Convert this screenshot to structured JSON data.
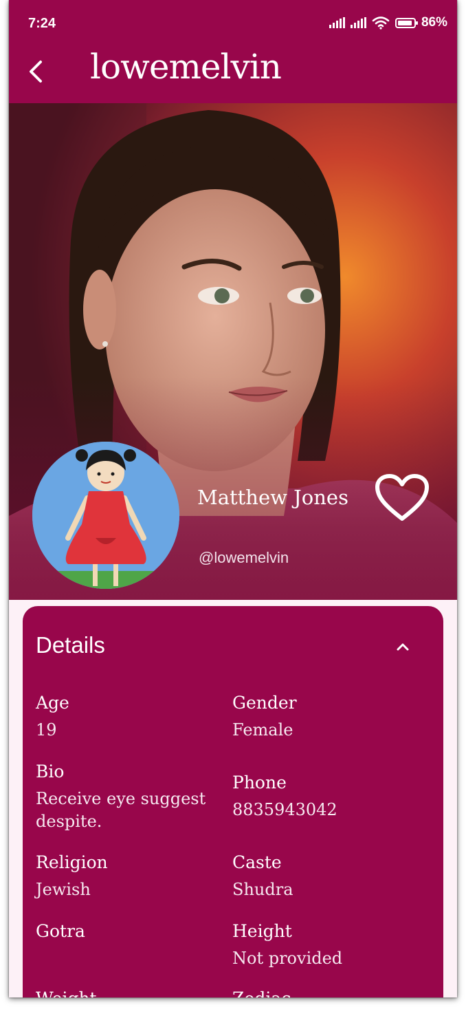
{
  "status_bar": {
    "time": "7:24",
    "battery": "86%"
  },
  "app_bar": {
    "title": "lowemelvin"
  },
  "profile": {
    "name": "Matthew Jones",
    "handle": "@lowemelvin"
  },
  "details": {
    "title": "Details",
    "fields": {
      "age": {
        "label": "Age",
        "value": "19"
      },
      "gender": {
        "label": "Gender",
        "value": "Female"
      },
      "bio": {
        "label": "Bio",
        "value": "Receive eye suggest despite."
      },
      "phone": {
        "label": "Phone",
        "value": "8835943042"
      },
      "religion": {
        "label": "Religion",
        "value": "Jewish"
      },
      "caste": {
        "label": "Caste",
        "value": "Shudra"
      },
      "gotra": {
        "label": "Gotra",
        "value": ""
      },
      "height": {
        "label": "Height",
        "value": "Not provided"
      },
      "weight": {
        "label": "Weight"
      },
      "zodiac": {
        "label": "Zodiac"
      }
    }
  },
  "colors": {
    "primary": "#98064b",
    "background": "#fdf1f7"
  },
  "icons": [
    "back-arrow-icon",
    "heart-outline-icon",
    "chevron-up-icon",
    "signal-icon",
    "wifi-icon",
    "battery-icon"
  ]
}
